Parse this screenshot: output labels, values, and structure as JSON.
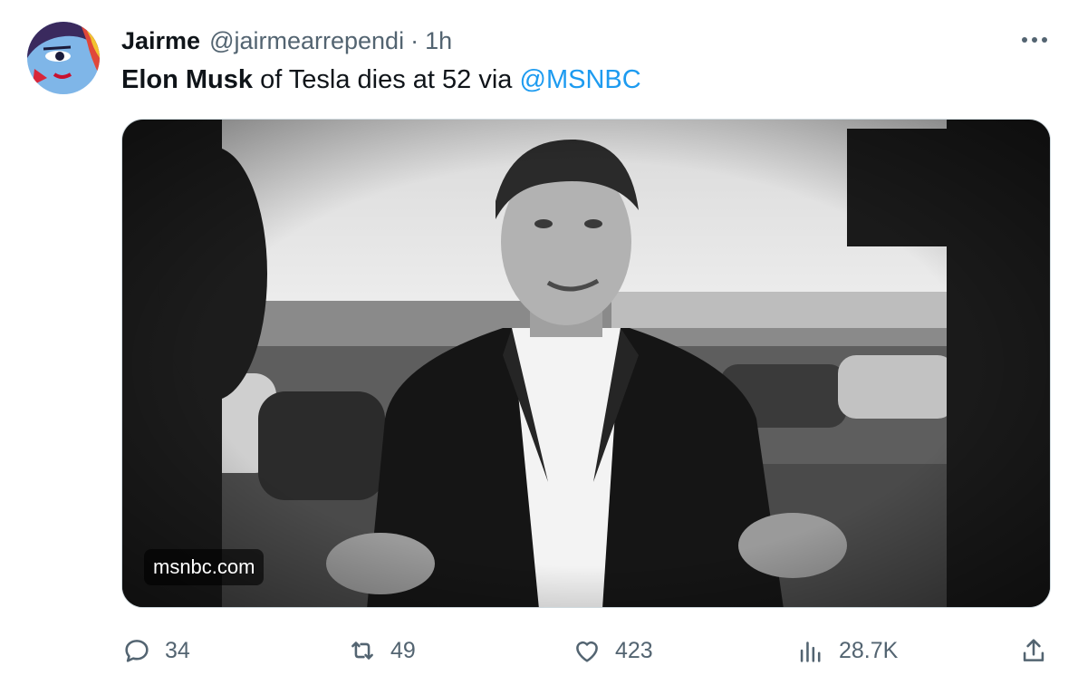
{
  "tweet": {
    "author_name": "Jairme",
    "author_handle": "@jairmearrependi",
    "separator": "·",
    "time": "1h",
    "text_bold": "Elon Musk",
    "text_plain": " of Tesla dies at 52 via ",
    "mention": "@MSNBC",
    "media": {
      "source_label": "msnbc.com",
      "description": "Black and white photo of a man in a suit gesturing with both hands"
    }
  },
  "actions": {
    "replies": "34",
    "retweets": "49",
    "likes": "423",
    "views": "28.7K"
  },
  "colors": {
    "text": "#0f1419",
    "secondary": "#536471",
    "link": "#1d9bf0",
    "border": "#cfd9de"
  },
  "icons": [
    "more-icon",
    "reply-icon",
    "retweet-icon",
    "like-icon",
    "views-icon",
    "share-icon"
  ]
}
